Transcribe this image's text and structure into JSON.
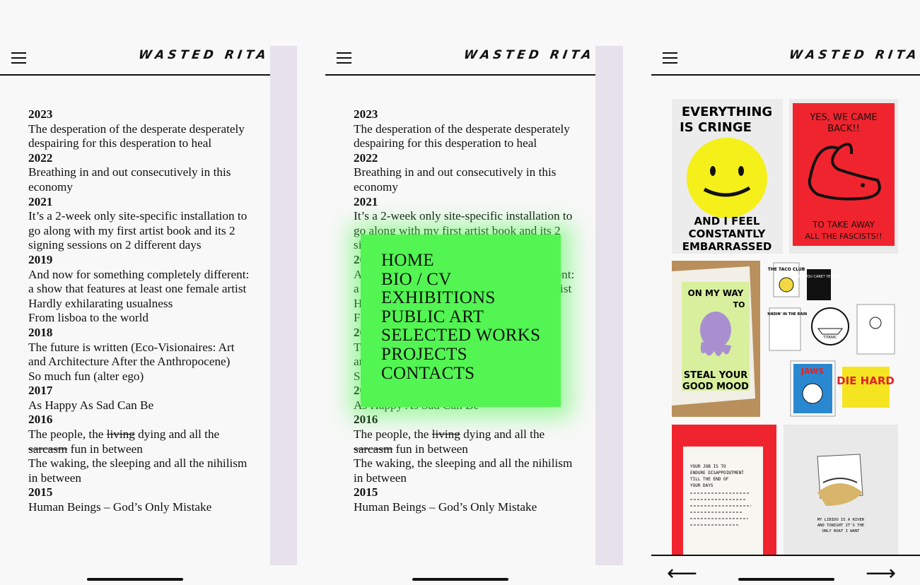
{
  "brand": {
    "logo_text": "WASTED RITA"
  },
  "exhibitions": [
    {
      "year": "2023",
      "items": [
        [
          {
            "t": "The desperation of the desperate desperately despairing for this desperation to heal"
          }
        ]
      ]
    },
    {
      "year": "2022",
      "items": [
        [
          {
            "t": "Breathing in and out consecutively in this economy"
          }
        ]
      ]
    },
    {
      "year": "2021",
      "items": [
        [
          {
            "t": "It’s a 2-week only site-specific installation to go along with my first artist book and its 2 signing sessions on 2 different days"
          }
        ]
      ]
    },
    {
      "year": "2019",
      "items": [
        [
          {
            "t": "And now for something completely different: a show that features at least one female artist"
          }
        ],
        [
          {
            "t": "Hardly exhilarating usualness"
          }
        ],
        [
          {
            "t": "From lisboa to the world"
          }
        ]
      ]
    },
    {
      "year": "2018",
      "items": [
        [
          {
            "t": "The future is written (Eco-Visionaires: Art and Architecture After the Anthropocene)"
          }
        ],
        [
          {
            "t": "So much fun (alter ego)"
          }
        ]
      ]
    },
    {
      "year": "2017",
      "items": [
        [
          {
            "t": "As Happy As Sad Can Be"
          }
        ]
      ]
    },
    {
      "year": "2016",
      "items": [
        [
          {
            "t": "The people, the "
          },
          {
            "t": "living",
            "s": true
          },
          {
            "t": " dying and all the "
          },
          {
            "t": "sarcasm",
            "s": true
          },
          {
            "t": " fun in between"
          }
        ],
        [
          {
            "t": "The waking, the sleeping and all the nihilism in between"
          }
        ]
      ]
    },
    {
      "year": "2015",
      "items": [
        [
          {
            "t": "Human Beings – God’s Only Mistake"
          }
        ]
      ]
    }
  ],
  "menu": {
    "items": [
      "HOME",
      "BIO / CV",
      "EXHIBITIONS",
      "PUBLIC ART",
      "SELECTED WORKS",
      "PROJECTS",
      "CONTACTS"
    ],
    "bg_color": "#52f552"
  },
  "gallery": {
    "items": [
      {
        "id": "everything-is-cringe",
        "lines": [
          "EVERYTHING",
          "IS CRINGE",
          "AND I FEEL",
          "CONSTANTLY",
          "EMBARRASSED"
        ]
      },
      {
        "id": "yes-we-came-back",
        "lines": [
          "YES, WE CAME",
          "BACK!!",
          "TO TAKE AWAY",
          "ALL THE FASCISTS!!"
        ]
      },
      {
        "id": "steal-your-good-mood",
        "lines": [
          "ON MY WAY",
          "TO",
          "STEAL YOUR",
          "GOOD MOOD"
        ]
      },
      {
        "id": "sticker-collection",
        "lines": [
          "THE TACO CLUB",
          "DO YOU CARE? YES NO",
          "STANDIN' IN THE RAIN",
          "TITANIC",
          "JAWS",
          "DIE HARD"
        ]
      },
      {
        "id": "handwritten-red-print",
        "lines": [
          "YOUR JOB IS TO",
          "ENDURE DISAPPOINTMENT",
          "TILL THE END OF",
          "YOUR DAYS"
        ]
      },
      {
        "id": "libido-drawing",
        "lines": [
          "MY LIBIDO IS A RIVER",
          "AND TONIGHT IT'S THE",
          "ONLY BOAT I WANT"
        ]
      }
    ]
  },
  "nav": {
    "prev_symbol": "⟵",
    "next_symbol": "⟶"
  },
  "colors": {
    "strip": "#e6e1ea",
    "bg": "#f8f8f8",
    "print_red": "#f0242e",
    "face_yellow": "#f5f019"
  }
}
